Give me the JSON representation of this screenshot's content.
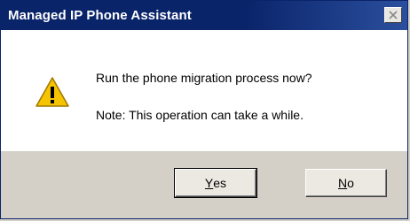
{
  "window": {
    "title": "Managed IP Phone Assistant",
    "close_icon": "close-icon"
  },
  "message": {
    "icon": "warning-icon",
    "question": "Run the phone migration process now?",
    "note": "Note:  This operation can take a while."
  },
  "buttons": {
    "yes_mnemonic": "Y",
    "yes_rest": "es",
    "no_mnemonic": "N",
    "no_rest": "o"
  },
  "colors": {
    "titlebar": "#0a246a",
    "warning": "#f5c400"
  }
}
